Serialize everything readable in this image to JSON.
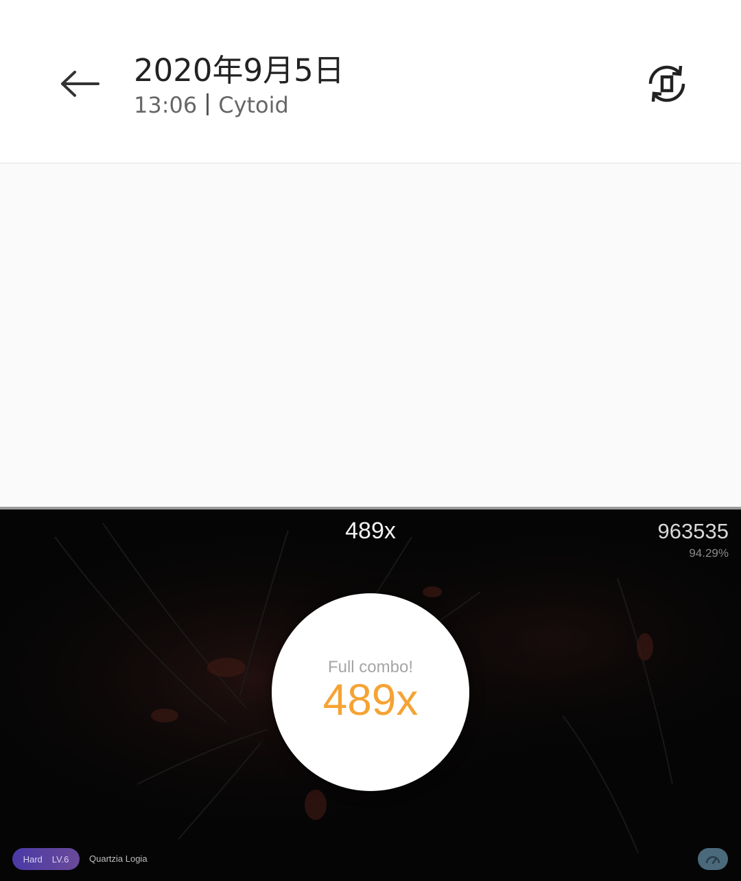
{
  "header": {
    "title": "2020年9月5日",
    "time": "13:06",
    "app_name": "Cytoid",
    "back_icon": "arrow-left-icon",
    "rotate_icon": "rotate-screen-icon"
  },
  "game": {
    "combo_top": "489x",
    "score": "963535",
    "accuracy": "94.29%",
    "full_combo_label": "Full combo!",
    "full_combo_count": "489x",
    "difficulty": "Hard",
    "level": "LV.6",
    "song_title": "Quartzia Logia",
    "speed_icon": "speedometer-icon",
    "colors": {
      "combo_accent": "#f5a334",
      "difficulty_pill": "#4a3aa6"
    }
  }
}
